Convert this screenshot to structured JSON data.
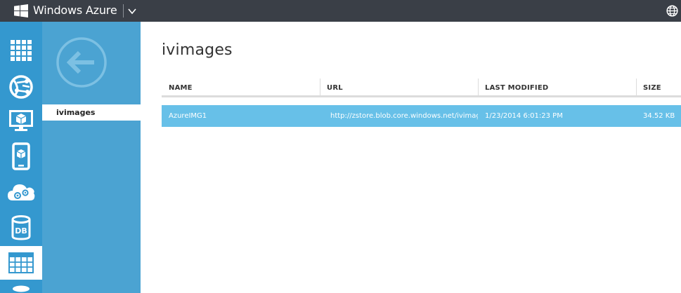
{
  "header": {
    "brand": "Windows Azure",
    "logo_icon": "windows-logo-icon",
    "menu_icon": "chevron-down-icon",
    "language_icon": "globe-icon"
  },
  "rail": {
    "items": [
      {
        "name": "all-items",
        "icon": "grid-icon"
      },
      {
        "name": "web-sites",
        "icon": "globe-network-icon"
      },
      {
        "name": "virtual-machines",
        "icon": "monitor-box-icon"
      },
      {
        "name": "mobile-services",
        "icon": "phone-box-icon"
      },
      {
        "name": "cloud-services",
        "icon": "cloud-gears-icon"
      },
      {
        "name": "sql-databases",
        "icon": "database-icon",
        "label": "DB"
      },
      {
        "name": "storage",
        "icon": "table-icon",
        "active": true
      },
      {
        "name": "more",
        "icon": "database-partial-icon"
      }
    ]
  },
  "subnav": {
    "back_icon": "back-arrow-icon",
    "items": [
      {
        "label": "ivimages",
        "selected": true
      }
    ]
  },
  "main": {
    "title": "ivimages",
    "columns": [
      "NAME",
      "URL",
      "LAST MODIFIED",
      "SIZE"
    ],
    "rows": [
      {
        "name": "AzureIMG1",
        "url": "http://zstore.blob.core.windows.net/ivimage",
        "last_modified": "1/23/2014 6:01:23 PM",
        "size": "34.52 KB",
        "selected": true
      }
    ]
  },
  "colors": {
    "topbar": "#3a3f47",
    "rail": "#3498cf",
    "subnav": "#4ba3d2",
    "selected_row": "#67c0e8"
  }
}
